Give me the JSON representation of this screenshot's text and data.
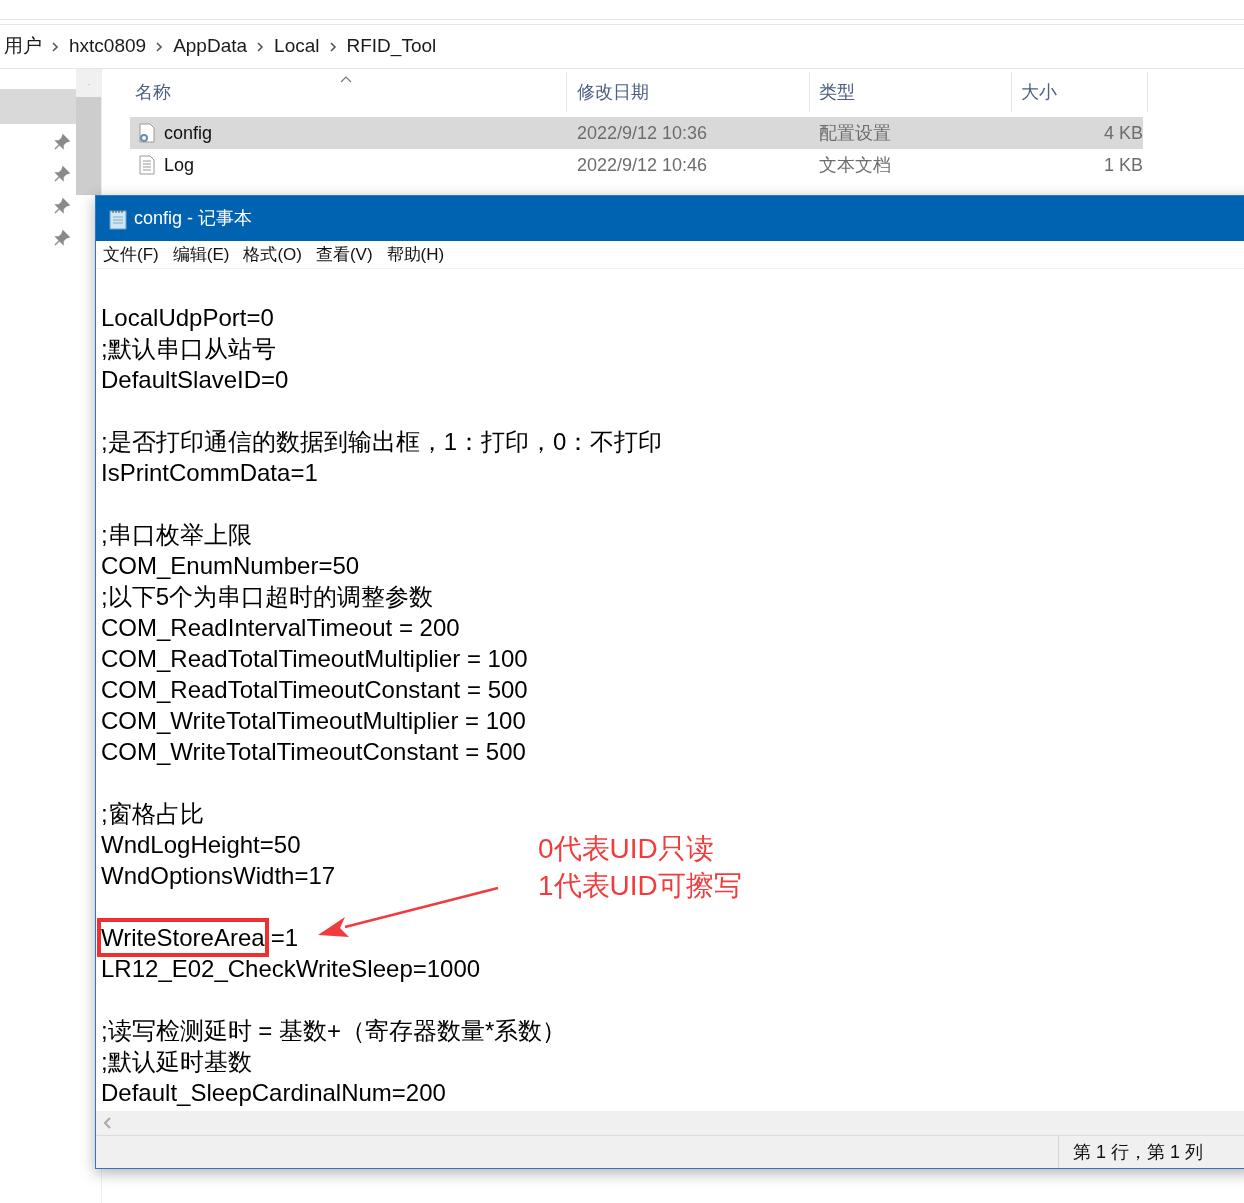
{
  "explorer": {
    "breadcrumb": [
      "用户",
      "hxtc0809",
      "AppData",
      "Local",
      "RFID_Tool"
    ],
    "columns": [
      "名称",
      "修改日期",
      "类型",
      "大小"
    ],
    "files": [
      {
        "name": "config",
        "modified": "2022/9/12 10:36",
        "type": "配置设置",
        "size": "4 KB",
        "kind": "settings",
        "selected": true
      },
      {
        "name": "Log",
        "modified": "2022/9/12 10:46",
        "type": "文本文档",
        "size": "1 KB",
        "kind": "text",
        "selected": false
      }
    ]
  },
  "notepad": {
    "title": "config - 记事本",
    "menu": [
      "文件(F)",
      "编辑(E)",
      "格式(O)",
      "查看(V)",
      "帮助(H)"
    ],
    "blocks": [
      [
        {
          "text": "LocalUdpPort=0",
          "boxed": false
        },
        {
          "text": ";默认串口从站号",
          "boxed": false
        },
        {
          "text": "DefaultSlaveID=0",
          "boxed": false
        }
      ],
      [
        {
          "text": ";是否打印通信的数据到输出框，1：打印，0：不打印",
          "boxed": false
        },
        {
          "text": "IsPrintCommData=1",
          "boxed": false
        }
      ],
      [
        {
          "text": ";串口枚举上限",
          "boxed": false
        },
        {
          "text": "COM_EnumNumber=50",
          "boxed": false
        },
        {
          "text": ";以下5个为串口超时的调整参数",
          "boxed": false
        },
        {
          "text": "COM_ReadIntervalTimeout = 200",
          "boxed": false
        },
        {
          "text": "COM_ReadTotalTimeoutMultiplier = 100",
          "boxed": false
        },
        {
          "text": "COM_ReadTotalTimeoutConstant = 500",
          "boxed": false
        },
        {
          "text": "COM_WriteTotalTimeoutMultiplier = 100",
          "boxed": false
        },
        {
          "text": "COM_WriteTotalTimeoutConstant = 500",
          "boxed": false
        }
      ],
      [
        {
          "text": ";窗格占比",
          "boxed": false
        },
        {
          "text": "WndLogHeight=50",
          "boxed": false
        },
        {
          "text": "WndOptionsWidth=17",
          "boxed": false
        }
      ],
      [
        {
          "text": "WriteStoreArea",
          "after": "=1",
          "boxed": true
        },
        {
          "text": "LR12_E02_CheckWriteSleep=1000",
          "boxed": false
        }
      ],
      [
        {
          "text": ";读写检测延时 = 基数+（寄存器数量*系数）",
          "boxed": false
        },
        {
          "text": ";默认延时基数",
          "boxed": false
        },
        {
          "text": "Default_SleepCardinalNum=200",
          "boxed": false
        }
      ]
    ],
    "status": "第 1 行，第 1 列"
  },
  "annotation": [
    "0代表UID只读",
    "1代表UID可擦写"
  ]
}
